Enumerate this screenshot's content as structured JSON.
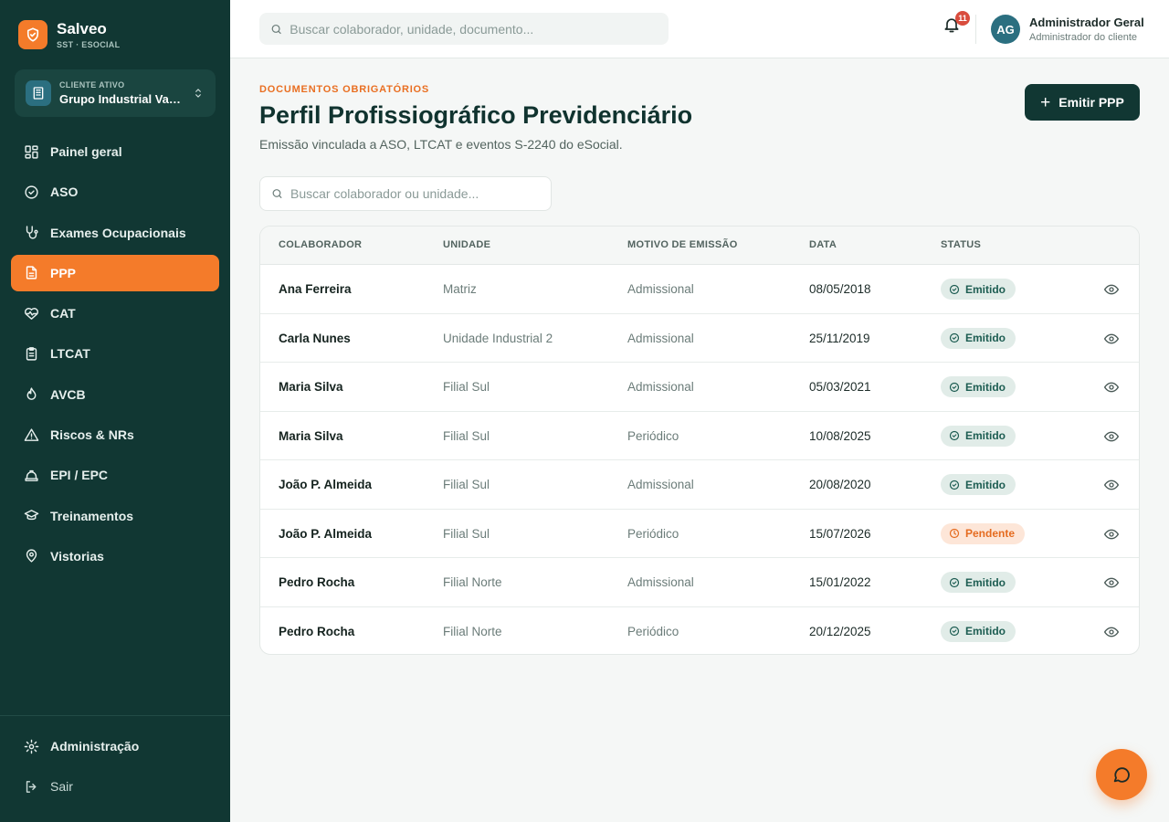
{
  "brand": {
    "name": "Salveo",
    "subtitle": "SST · ESOCIAL"
  },
  "client": {
    "label": "CLIENTE ATIVO",
    "name": "Grupo Industrial Val..."
  },
  "sidebar": {
    "items": [
      {
        "label": "Painel geral",
        "icon": "dashboard-icon"
      },
      {
        "label": "ASO",
        "icon": "check-circle-icon"
      },
      {
        "label": "Exames Ocupacionais",
        "icon": "stethoscope-icon"
      },
      {
        "label": "PPP",
        "icon": "document-icon",
        "active": true
      },
      {
        "label": "CAT",
        "icon": "heart-pulse-icon"
      },
      {
        "label": "LTCAT",
        "icon": "clipboard-icon"
      },
      {
        "label": "AVCB",
        "icon": "flame-icon"
      },
      {
        "label": "Riscos & NRs",
        "icon": "warning-icon"
      },
      {
        "label": "EPI / EPC",
        "icon": "hard-hat-icon"
      },
      {
        "label": "Treinamentos",
        "icon": "graduation-cap-icon"
      },
      {
        "label": "Vistorias",
        "icon": "map-pin-icon"
      }
    ],
    "bottom": [
      {
        "label": "Administração",
        "icon": "gear-icon"
      },
      {
        "label": "Sair",
        "icon": "logout-icon"
      }
    ]
  },
  "topbar": {
    "search_placeholder": "Buscar colaborador, unidade, documento...",
    "notification_count": "11",
    "avatar_initials": "AG",
    "user_name": "Administrador Geral",
    "user_role": "Administrador do cliente"
  },
  "page": {
    "eyebrow": "DOCUMENTOS OBRIGATÓRIOS",
    "title": "Perfil Profissiográfico Previdenciário",
    "subtitle": "Emissão vinculada a ASO, LTCAT e eventos S-2240 do eSocial.",
    "emit_button": "Emitir PPP",
    "table_search_placeholder": "Buscar colaborador ou unidade..."
  },
  "table": {
    "headers": [
      "COLABORADOR",
      "UNIDADE",
      "MOTIVO DE EMISSÃO",
      "DATA",
      "STATUS"
    ],
    "rows": [
      {
        "colaborador": "Ana Ferreira",
        "unidade": "Matriz",
        "motivo": "Admissional",
        "data": "08/05/2018",
        "status": "Emitido"
      },
      {
        "colaborador": "Carla Nunes",
        "unidade": "Unidade Industrial 2",
        "motivo": "Admissional",
        "data": "25/11/2019",
        "status": "Emitido"
      },
      {
        "colaborador": "Maria Silva",
        "unidade": "Filial Sul",
        "motivo": "Admissional",
        "data": "05/03/2021",
        "status": "Emitido"
      },
      {
        "colaborador": "Maria Silva",
        "unidade": "Filial Sul",
        "motivo": "Periódico",
        "data": "10/08/2025",
        "status": "Emitido"
      },
      {
        "colaborador": "João P. Almeida",
        "unidade": "Filial Sul",
        "motivo": "Admissional",
        "data": "20/08/2020",
        "status": "Emitido"
      },
      {
        "colaborador": "João P. Almeida",
        "unidade": "Filial Sul",
        "motivo": "Periódico",
        "data": "15/07/2026",
        "status": "Pendente"
      },
      {
        "colaborador": "Pedro Rocha",
        "unidade": "Filial Norte",
        "motivo": "Admissional",
        "data": "15/01/2022",
        "status": "Emitido"
      },
      {
        "colaborador": "Pedro Rocha",
        "unidade": "Filial Norte",
        "motivo": "Periódico",
        "data": "20/12/2025",
        "status": "Emitido"
      }
    ]
  },
  "colors": {
    "sidebar_bg": "#113733",
    "accent": "#f47b2a",
    "emitido": "#1d5d52",
    "pendente": "#e56b1f"
  }
}
